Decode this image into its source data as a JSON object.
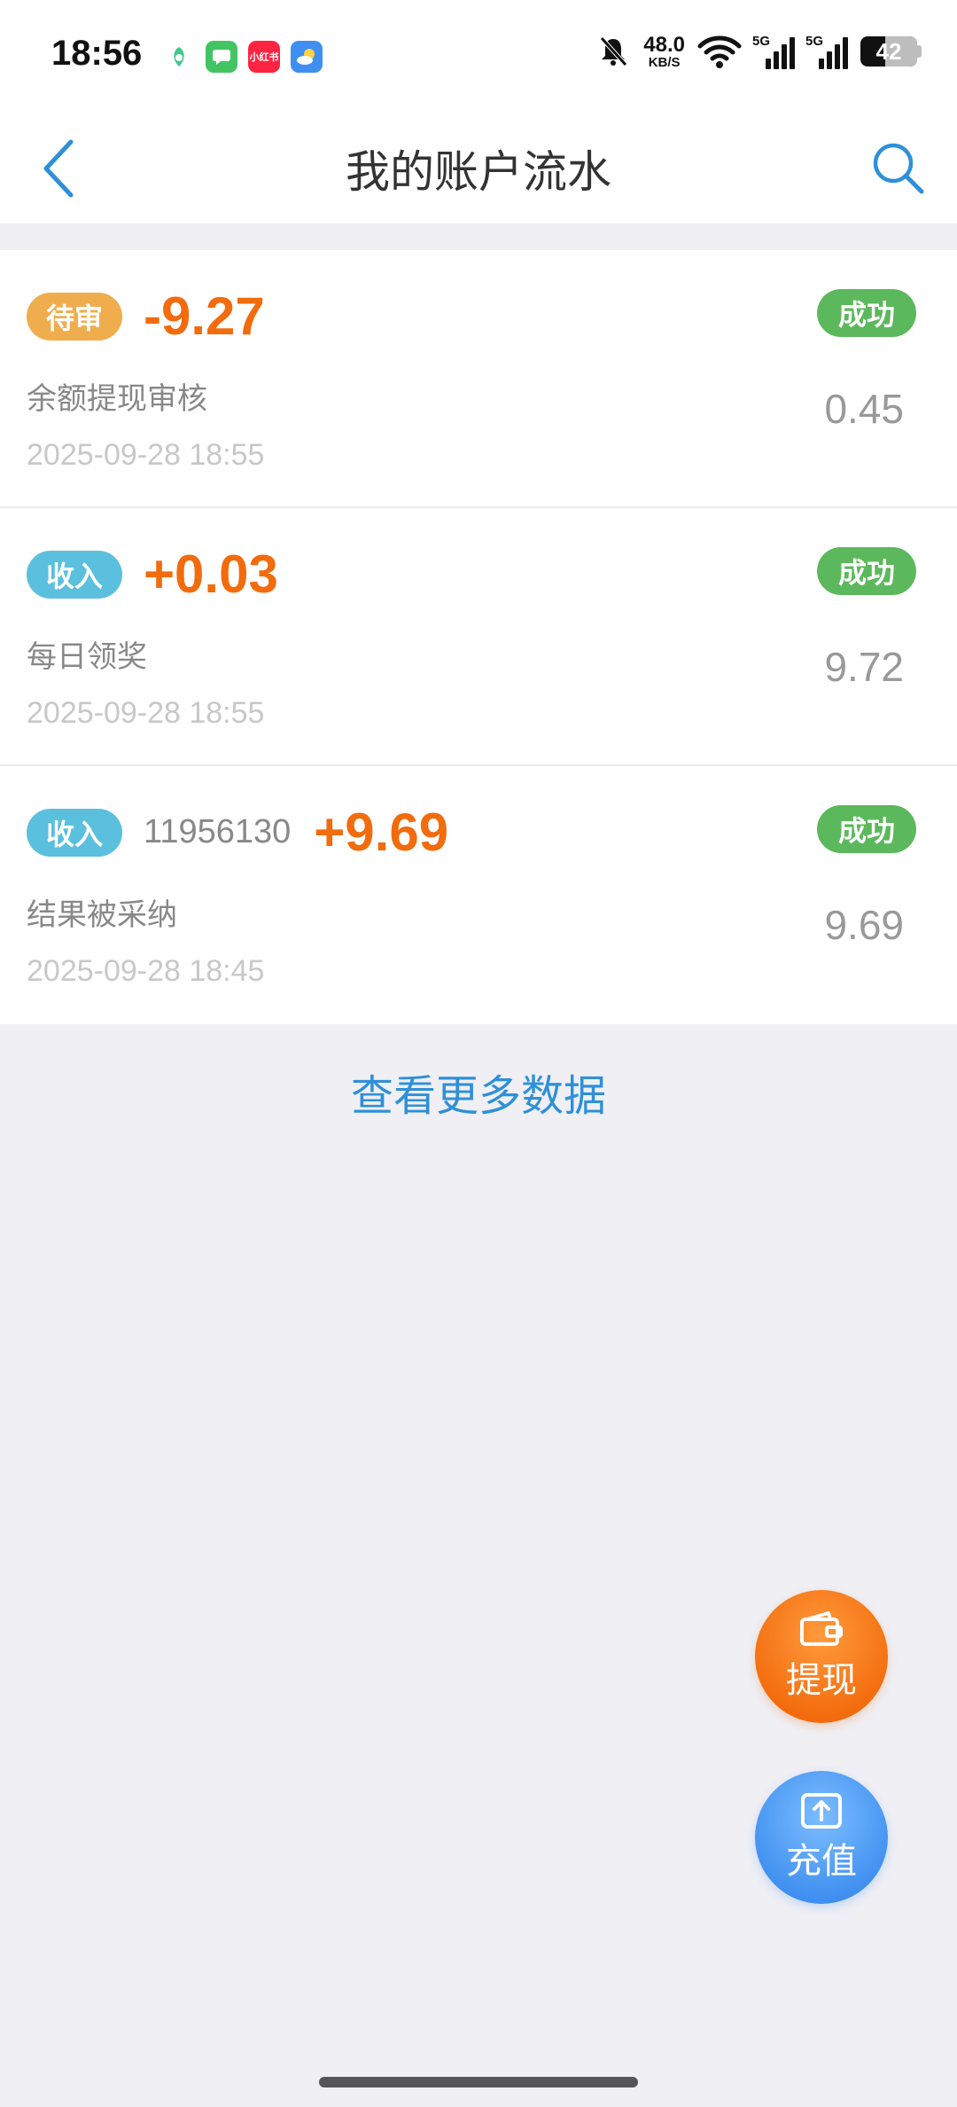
{
  "status_bar": {
    "time": "18:56",
    "net_speed_value": "48.0",
    "net_speed_unit": "KB/S",
    "signal_1_label": "5G",
    "signal_2_label": "5G",
    "battery": "42",
    "app_icon_3_label": "小红书"
  },
  "nav": {
    "title": "我的账户流水"
  },
  "records": [
    {
      "type_label": "待审",
      "type": "pending",
      "id": "",
      "amount": "-9.27",
      "desc": "余额提现审核",
      "time": "2025-09-28 18:55",
      "status": "成功",
      "balance": "0.45"
    },
    {
      "type_label": "收入",
      "type": "income",
      "id": "",
      "amount": "+0.03",
      "desc": "每日领奖",
      "time": "2025-09-28 18:55",
      "status": "成功",
      "balance": "9.72"
    },
    {
      "type_label": "收入",
      "type": "income",
      "id": "11956130",
      "amount": "+9.69",
      "desc": "结果被采纳",
      "time": "2025-09-28 18:45",
      "status": "成功",
      "balance": "9.69"
    }
  ],
  "more_link": "查看更多数据",
  "fab": {
    "withdraw_label": "提现",
    "recharge_label": "充值"
  },
  "colors": {
    "accent_blue": "#2e90d8",
    "amount_orange": "#f26b0c",
    "pending": "#f0ad4e",
    "income": "#5bc0de",
    "success": "#5cb85c"
  }
}
